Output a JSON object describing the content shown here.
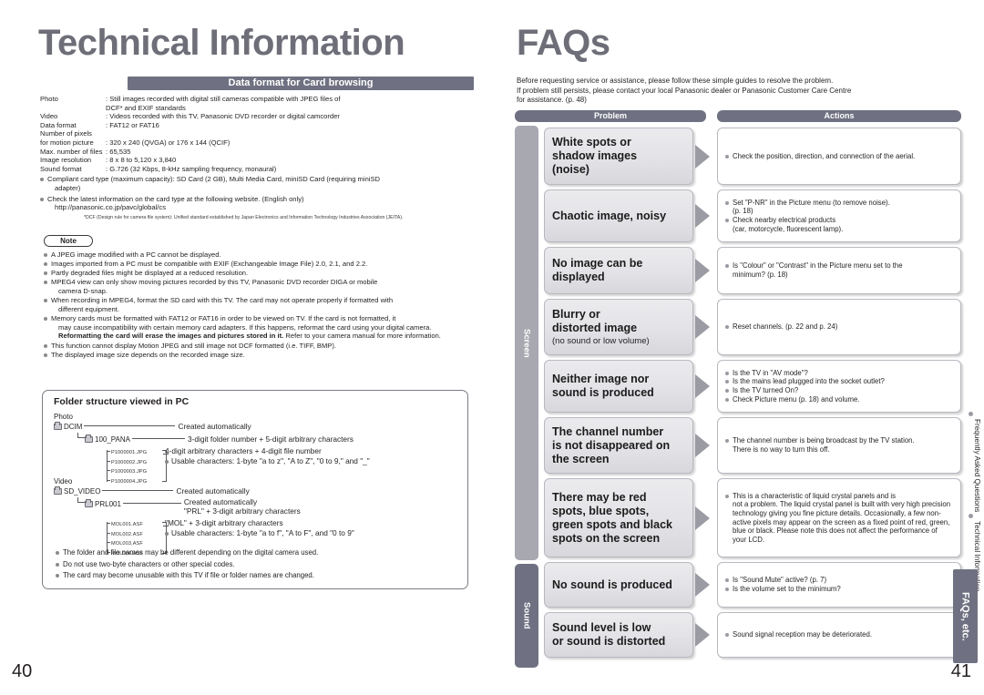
{
  "left": {
    "title": "Technical Information",
    "page_number": "40",
    "section_bar": "Data format for Card browsing",
    "spec_rows": [
      {
        "label": "Photo",
        "value": ": Still images recorded with digital still cameras compatible with JPEG files of",
        "cont": "DCF* and EXIF standards"
      },
      {
        "label": "Video",
        "value": ": Videos recorded with this TV, Panasonic DVD recorder or digital camcorder",
        "cont": ""
      },
      {
        "label": "Data format",
        "value": ": FAT12 or FAT16",
        "cont": ""
      },
      {
        "label": "Number of pixels",
        "value": "",
        "cont": ""
      },
      {
        "label": "for motion picture",
        "value": ": 320 x 240 (QVGA) or 176 x 144 (QCIF)",
        "cont": ""
      },
      {
        "label": "Max. number of files",
        "value": ": 65,535",
        "cont": ""
      },
      {
        "label": "Image resolution",
        "value": ": 8 x 8 to 5,120 x 3,840",
        "cont": ""
      },
      {
        "label": "Sound format",
        "value": ": G.726 (32 Kbps, 8-kHz sampling frequency, monaural)",
        "cont": ""
      }
    ],
    "spec_bullets": [
      {
        "text": "Compliant card type (maximum capacity): SD Card (2 GB), Multi Media Card, miniSD Card (requiring miniSD",
        "cont": "adapter)"
      },
      {
        "text": "Check the latest information on the card type at the following website. (English only)",
        "cont": "http://panasonic.co.jp/pavc/global/cs"
      }
    ],
    "footnote": "*DCF (Design rule for camera file system): Unified standard established by Japan Electronics and Information Technology Industries Association (JEITA).",
    "note_badge": "Note",
    "notes": [
      {
        "text": "A JPEG image modified with a PC cannot be displayed.",
        "cont": ""
      },
      {
        "text": "Images imported from a PC must be compatible with EXIF (Exchangeable Image File) 2.0, 2.1, and 2.2.",
        "cont": ""
      },
      {
        "text": "Partly degraded files might be displayed at a reduced resolution.",
        "cont": ""
      },
      {
        "text": "MPEG4 view can only show moving pictures recorded by this TV, Panasonic DVD recorder DIGA or mobile",
        "cont": "camera D-snap."
      },
      {
        "text": "When recording in MPEG4, format the SD card with this TV. The card may not operate properly if formatted with",
        "cont": "different equipment."
      },
      {
        "text": "Memory cards must be formatted with FAT12 or FAT16 in order to be viewed on TV. If the card is not formatted, it",
        "cont": "may cause incompatibility with certain memory card adapters. If this happens, reformat the card using your digital camera."
      },
      {
        "text": "This function cannot display Motion JPEG and still image not DCF formatted (i.e. TIFF, BMP).",
        "cont": ""
      },
      {
        "text": "The displayed image size depends on the recorded image size.",
        "cont": ""
      }
    ],
    "note_bold_line": "Reformatting the card will erase the images and pictures stored in it.",
    "note_bold_tail": " Refer to your camera manual for more information.",
    "folder": {
      "title": "Folder structure viewed in PC",
      "photo_label": "Photo",
      "photo_root": "DCIM",
      "photo_root_desc": "Created automatically",
      "photo_sub": "100_PANA",
      "photo_sub_desc": "3-digit folder number + 5-digit arbitrary characters",
      "photo_files": [
        "P1000001.JPG",
        "P1000002.JPG",
        "P1000003.JPG",
        "P1000004.JPG"
      ],
      "photo_files_desc": "4-digit arbitrary characters + 4-digit file number",
      "photo_files_bullet": "Usable characters: 1-byte \"a to z\", \"A to Z\", \"0 to 9,\" and \"_\"",
      "video_label": "Video",
      "video_root": "SD_VIDEO",
      "video_root_desc": "Created automatically",
      "video_sub": "PRL001",
      "video_sub_desc": "Created automatically",
      "video_sub_desc2": "\"PRL\" + 3-digit arbitrary characters",
      "video_files": [
        "MOL001.ASF",
        "MOL002.ASF",
        "MOL003.ASF",
        "MOL004.ASF"
      ],
      "video_files_desc": "\"MOL\" + 3-digit arbitrary characters",
      "video_files_bullet": "Usable characters: 1-byte \"a to f\", \"A to F\", and \"0 to 9\"",
      "notes": [
        "The folder and file names may be different depending on the digital camera used.",
        "Do not use two-byte characters or other special codes.",
        "The card may become unusable with this TV if file or folder names are changed."
      ]
    }
  },
  "right": {
    "title": "FAQs",
    "page_number": "41",
    "intro": [
      "Before requesting service or assistance, please follow these simple guides to resolve the problem.",
      "If problem still persists, please contact your local Panasonic dealer or Panasonic Customer Care Centre",
      "for assistance. (p. 48)"
    ],
    "col_problem": "Problem",
    "col_actions": "Actions",
    "cat_screen": "Screen",
    "cat_sound": "Sound",
    "rows": [
      {
        "problem": [
          "White spots or",
          "shadow images",
          "(noise)"
        ],
        "problem_sub": "",
        "actions": [
          {
            "text": "Check the position, direction, and connection of the aerial.",
            "cont": ""
          }
        ]
      },
      {
        "problem": [
          "Chaotic image, noisy"
        ],
        "problem_sub": "",
        "actions": [
          {
            "text": "Set \"P-NR\" in the Picture menu (to remove noise).",
            "cont": "(p. 18)"
          },
          {
            "text": "Check nearby electrical products",
            "cont": "(car, motorcycle, fluorescent lamp)."
          }
        ]
      },
      {
        "problem": [
          "No image can be",
          "displayed"
        ],
        "problem_sub": "",
        "actions": [
          {
            "text": "Is \"Colour\" or \"Contrast\" in the Picture menu set to the",
            "cont": "minimum? (p. 18)"
          }
        ]
      },
      {
        "problem": [
          "Blurry or",
          "distorted image"
        ],
        "problem_sub": "(no sound or low volume)",
        "actions": [
          {
            "text": "Reset channels. (p. 22 and p. 24)",
            "cont": ""
          }
        ]
      },
      {
        "problem": [
          "Neither image nor",
          "sound is produced"
        ],
        "problem_sub": "",
        "actions": [
          {
            "text": "Is the TV in \"AV mode\"?",
            "cont": ""
          },
          {
            "text": "Is the mains lead plugged into the socket outlet?",
            "cont": ""
          },
          {
            "text": "Is the TV turned On?",
            "cont": ""
          },
          {
            "text": "Check Picture menu (p. 18) and volume.",
            "cont": ""
          }
        ]
      },
      {
        "problem": [
          "The channel number",
          "is not disappeared on",
          "the screen"
        ],
        "problem_sub": "",
        "actions": [
          {
            "text": "The channel number is being broadcast by the TV station.",
            "cont": "There is no way to turn this off."
          }
        ]
      },
      {
        "problem": [
          "There may be red",
          "spots, blue spots,",
          "green spots and black",
          "spots on the screen"
        ],
        "problem_sub": "",
        "actions": [
          {
            "text": "This is a characteristic of liquid crystal panels and is",
            "cont": "not a problem. The liquid crystal panel is built with very high precision technology giving you fine picture details. Occasionally, a few non-active pixels may appear on the screen as a fixed point of red, green, blue or black. Please note this does not affect the performance of your LCD."
          }
        ]
      },
      {
        "problem": [
          "No sound is produced"
        ],
        "problem_sub": "",
        "actions": [
          {
            "text": "Is \"Sound Mute\" active? (p. 7)",
            "cont": ""
          },
          {
            "text": "Is the volume set to the minimum?",
            "cont": ""
          }
        ]
      },
      {
        "problem": [
          "Sound level is low",
          "or sound is distorted"
        ],
        "problem_sub": "",
        "actions": [
          {
            "text": "Sound signal reception may be deteriorated.",
            "cont": ""
          }
        ]
      }
    ],
    "side_lines": [
      "Frequently Asked Questions",
      "Technical Information"
    ],
    "side_tab": "FAQs, etc."
  },
  "colors": {
    "header_bar": "#6f7081",
    "title": "#6d6e78",
    "band_screen": "#a7a8b0",
    "band_sound": "#6f7081",
    "arrow": "#9b9ba4"
  }
}
